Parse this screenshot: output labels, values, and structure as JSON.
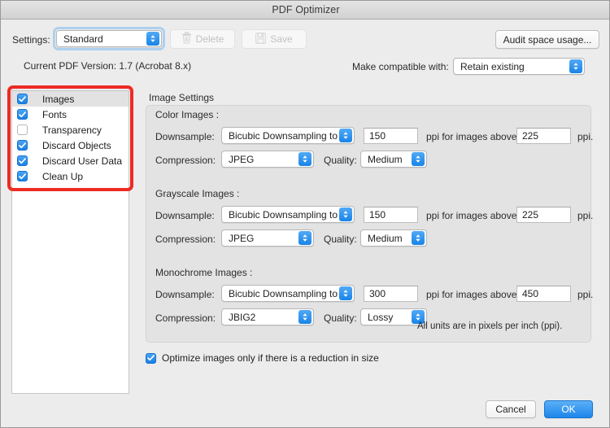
{
  "window": {
    "title": "PDF Optimizer"
  },
  "toolbar": {
    "settings_label": "Settings:",
    "settings_value": "Standard",
    "delete_label": "Delete",
    "delete_icon": "trash-icon",
    "save_label": "Save",
    "save_icon": "floppy-disk-icon",
    "audit_label": "Audit space usage..."
  },
  "info": {
    "pdf_version": "Current PDF Version: 1.7 (Acrobat 8.x)",
    "compatible_label": "Make compatible with:",
    "compatible_value": "Retain existing"
  },
  "sidebar": {
    "items": [
      {
        "label": "Images",
        "checked": true,
        "selected": true
      },
      {
        "label": "Fonts",
        "checked": true,
        "selected": false
      },
      {
        "label": "Transparency",
        "checked": false,
        "selected": false
      },
      {
        "label": "Discard Objects",
        "checked": true,
        "selected": false
      },
      {
        "label": "Discard User Data",
        "checked": true,
        "selected": false
      },
      {
        "label": "Clean Up",
        "checked": true,
        "selected": false
      }
    ]
  },
  "annotation": {
    "color": "#ee2a24",
    "target": "sidebar-checkbox-list"
  },
  "image_settings": {
    "group_title": "Image Settings",
    "downsample_label": "Downsample:",
    "compression_label": "Compression:",
    "quality_label": "Quality:",
    "ppi_above_label": "ppi for images above",
    "ppi_suffix": "ppi.",
    "units_note": "All units are in pixels per inch (ppi).",
    "sections": [
      {
        "title": "Color Images :",
        "downsample_method": "Bicubic Downsampling to",
        "downsample_ppi": "150",
        "threshold_ppi": "225",
        "compression": "JPEG",
        "quality": "Medium"
      },
      {
        "title": "Grayscale Images :",
        "downsample_method": "Bicubic Downsampling to",
        "downsample_ppi": "150",
        "threshold_ppi": "225",
        "compression": "JPEG",
        "quality": "Medium"
      },
      {
        "title": "Monochrome Images :",
        "downsample_method": "Bicubic Downsampling to",
        "downsample_ppi": "300",
        "threshold_ppi": "450",
        "compression": "JBIG2",
        "quality": "Lossy"
      }
    ]
  },
  "footer": {
    "optimize_label": "Optimize images only if there is a reduction in size",
    "optimize_checked": true,
    "cancel_label": "Cancel",
    "ok_label": "OK",
    "accent_color": "#1d85ea"
  }
}
